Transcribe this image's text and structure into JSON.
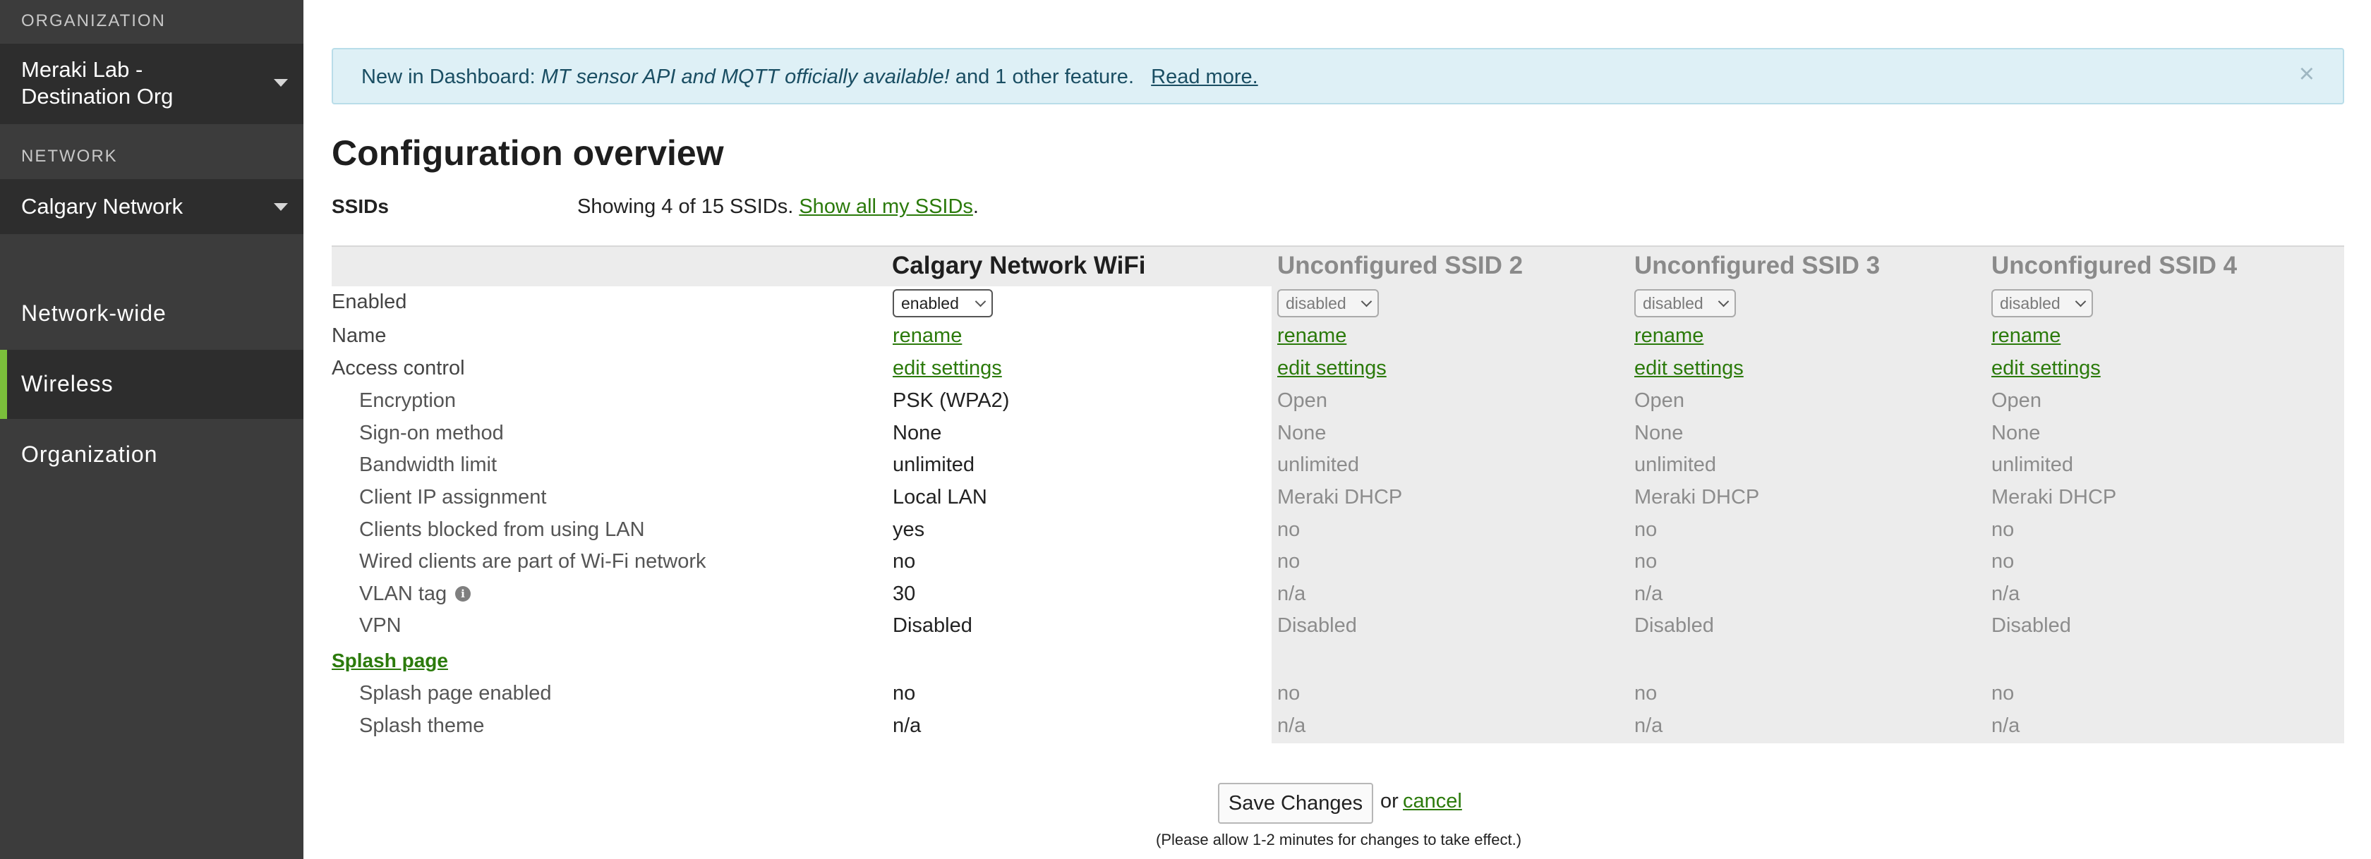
{
  "sidebar": {
    "org_label": "ORGANIZATION",
    "org_line1": "Meraki Lab -",
    "org_line2": "Destination Org",
    "network_label": "NETWORK",
    "network_value": "Calgary Network",
    "nav": [
      "Network-wide",
      "Wireless",
      "Organization"
    ],
    "active_nav": "Wireless",
    "accent_color": "#7bbf3b"
  },
  "banner": {
    "prefix": "New in Dashboard: ",
    "feature": "MT sensor API and MQTT officially available!",
    "suffix": " and 1 other feature.",
    "read_more": "Read more.",
    "close_icon": "close-icon"
  },
  "page": {
    "title": "Configuration overview",
    "ssids_label": "SSIDs",
    "summary_prefix": "Showing 4 of 15 SSIDs. ",
    "summary_link": "Show all my SSIDs",
    "summary_suffix": "."
  },
  "columns": [
    "Calgary Network WiFi",
    "Unconfigured SSID 2",
    "Unconfigured SSID 3",
    "Unconfigured SSID 4"
  ],
  "rows": {
    "enabled": {
      "label": "Enabled",
      "values": [
        "enabled",
        "disabled",
        "disabled",
        "disabled"
      ]
    },
    "name": {
      "label": "Name",
      "values": [
        "rename",
        "rename",
        "rename",
        "rename"
      ]
    },
    "access_control": {
      "label": "Access control",
      "values": [
        "edit settings",
        "edit settings",
        "edit settings",
        "edit settings"
      ]
    },
    "encryption": {
      "label": "Encryption",
      "values": [
        "PSK (WPA2)",
        "Open",
        "Open",
        "Open"
      ]
    },
    "sign_on": {
      "label": "Sign-on method",
      "values": [
        "None",
        "None",
        "None",
        "None"
      ]
    },
    "bandwidth": {
      "label": "Bandwidth limit",
      "values": [
        "unlimited",
        "unlimited",
        "unlimited",
        "unlimited"
      ]
    },
    "client_ip": {
      "label": "Client IP assignment",
      "values": [
        "Local LAN",
        "Meraki DHCP",
        "Meraki DHCP",
        "Meraki DHCP"
      ]
    },
    "blocked_lan": {
      "label": "Clients blocked from using LAN",
      "values": [
        "yes",
        "no",
        "no",
        "no"
      ]
    },
    "wired_clients": {
      "label": "Wired clients are part of Wi-Fi network",
      "values": [
        "no",
        "no",
        "no",
        "no"
      ]
    },
    "vlan": {
      "label": "VLAN tag",
      "values": [
        "30",
        "n/a",
        "n/a",
        "n/a"
      ]
    },
    "vpn": {
      "label": "VPN",
      "values": [
        "Disabled",
        "Disabled",
        "Disabled",
        "Disabled"
      ]
    },
    "splash_header": "Splash page",
    "splash_enabled": {
      "label": "Splash page enabled",
      "values": [
        "no",
        "no",
        "no",
        "no"
      ]
    },
    "splash_theme": {
      "label": "Splash theme",
      "values": [
        "n/a",
        "n/a",
        "n/a",
        "n/a"
      ]
    }
  },
  "footer": {
    "save": "Save Changes",
    "or": "or",
    "cancel": "cancel",
    "note": "(Please allow 1-2 minutes for changes to take effect.)"
  },
  "colors": {
    "link": "#2b7a0b",
    "banner_bg": "#def0f6",
    "sidebar_bg": "#3c3c3c"
  }
}
